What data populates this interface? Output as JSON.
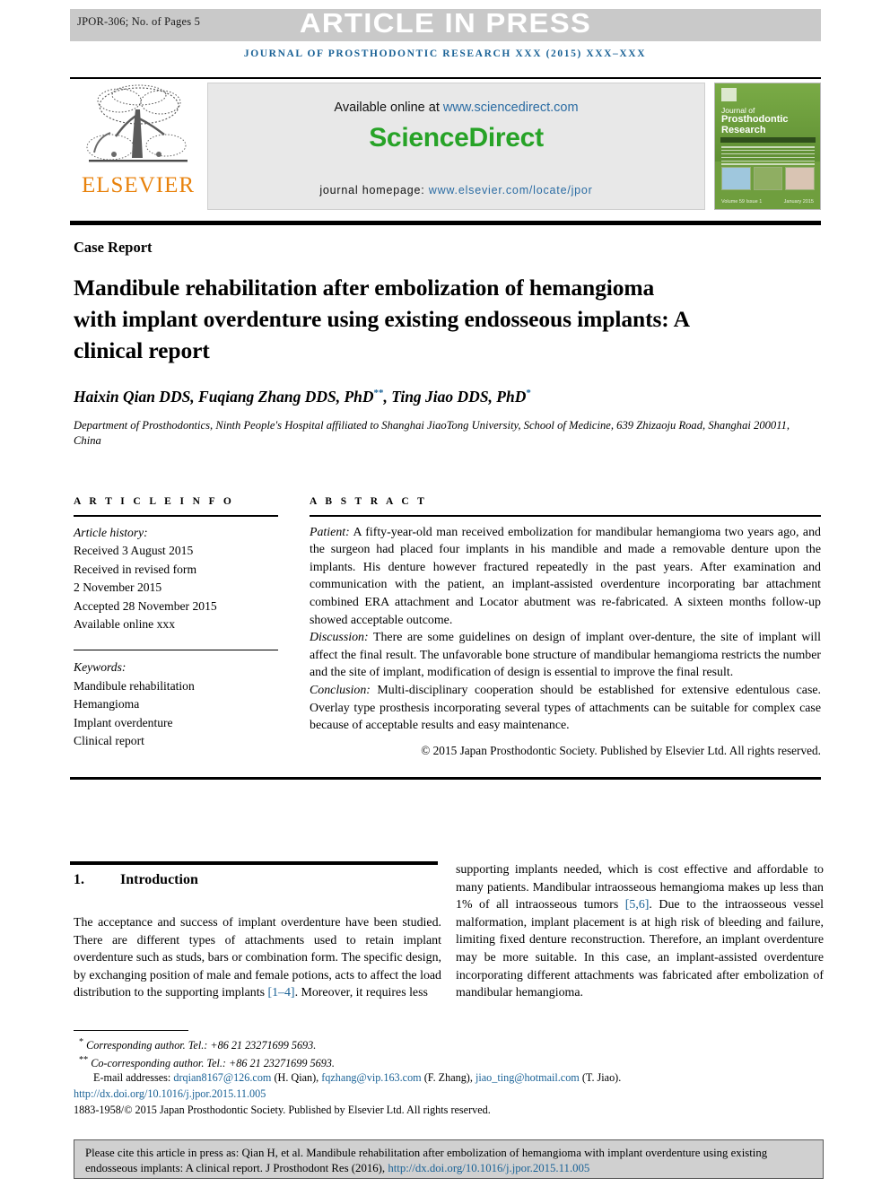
{
  "header": {
    "jpor_code": "JPOR-306; No. of Pages 5",
    "press_banner": "ARTICLE IN PRESS",
    "journal_line": "JOURNAL OF PROSTHODONTIC RESEARCH XXX (2015) XXX–XXX",
    "band_color": "#c9c9c9",
    "journal_line_color": "#1a6296"
  },
  "masthead": {
    "elsevier_wordmark": "ELSEVIER",
    "elsevier_color": "#e8820c",
    "available_prefix": "Available online at ",
    "available_link": "www.sciencedirect.com",
    "sciencedirect_logo": "ScienceDirect",
    "sciencedirect_color": "#27a327",
    "homepage_prefix": "journal homepage: ",
    "homepage_link": "www.elsevier.com/locate/jpor",
    "cover": {
      "line1": "Journal of",
      "line2": "Prosthodontic Research",
      "society": "Official Journal of Japan Prosthodontic Society",
      "bullets": [
        "Effect of implant-supported removable partial dentures on oral health related quality of life",
        "Clinical outcomes of implant placement in the posterior mandible"
      ],
      "volume": "Volume 59 Issue 1",
      "date": "January 2015",
      "cover_color": "#6f9e3e"
    }
  },
  "article": {
    "type": "Case Report",
    "title": "Mandibule rehabilitation after embolization of hemangioma with implant overdenture using existing endosseous implants: A clinical report",
    "authors": "Haixin Qian DDS, Fuqiang Zhang DDS, PhD",
    "author_mark_1": "**",
    "authors_cont": ", Ting Jiao DDS, PhD",
    "author_mark_2": "*",
    "affiliation": "Department of Prosthodontics, Ninth People's Hospital affiliated to Shanghai JiaoTong University, School of Medicine, 639 Zhizaoju Road, Shanghai 200011, China"
  },
  "article_info": {
    "heading": "A R T I C L E   I N F O",
    "history_label": "Article history:",
    "history": [
      "Received 3 August 2015",
      "Received in revised form",
      "2 November 2015",
      "Accepted 28 November 2015",
      "Available online xxx"
    ],
    "keywords_label": "Keywords:",
    "keywords": [
      "Mandibule rehabilitation",
      "Hemangioma",
      "Implant overdenture",
      "Clinical report"
    ]
  },
  "abstract": {
    "heading": "A B S T R A C T",
    "patient_label": "Patient:",
    "patient_text": " A fifty-year-old man received embolization for mandibular hemangioma two years ago, and the surgeon had placed four implants in his mandible and made a removable denture upon the implants. His denture however fractured repeatedly in the past years. After examination and communication with the patient, an implant-assisted overdenture incorporating bar attachment combined ERA attachment and Locator abutment was re-fabricated. A sixteen months follow-up showed acceptable outcome.",
    "discussion_label": "Discussion:",
    "discussion_text": " There are some guidelines on design of implant over-denture, the site of implant will affect the final result. The unfavorable bone structure of mandibular hemangioma restricts the number and the site of implant, modification of design is essential to improve the final result.",
    "conclusion_label": "Conclusion:",
    "conclusion_text": " Multi-disciplinary cooperation should be established for extensive edentulous case. Overlay type prosthesis incorporating several types of attachments can be suitable for complex case because of acceptable results and easy maintenance.",
    "copyright": "© 2015 Japan Prosthodontic Society. Published by Elsevier Ltd. All rights reserved."
  },
  "body": {
    "section_number": "1.",
    "section_title": "Introduction",
    "left_p1_a": "The acceptance and success of implant overdenture have been studied. There are different types of attachments used to retain implant overdenture such as studs, bars or combination form. The specific design, by exchanging position of male and female potions, acts to affect the load distribution to the supporting implants ",
    "left_ref1": "[1–4]",
    "left_p1_b": ". Moreover, it requires less",
    "right_p1_a": "supporting implants needed, which is cost effective and affordable to many patients. Mandibular intraosseous hemangioma makes up less than 1% of all intraosseous tumors ",
    "right_ref1": "[5,6]",
    "right_p1_b": ". Due to the intraosseous vessel malformation, implant placement is at high risk of bleeding and failure, limiting fixed denture reconstruction. Therefore, an implant overdenture may be more suitable. In this case, an implant-assisted overdenture incorporating different attachments was fabricated after embolization of mandibular hemangioma."
  },
  "footnotes": {
    "corresponding_mark": "*",
    "corresponding": " Corresponding author. Tel.: +86 21 23271699 5693.",
    "co_corresponding_mark": "**",
    "co_corresponding": " Co-corresponding author. Tel.: +86 21 23271699 5693.",
    "email_label": "E-mail addresses: ",
    "email1": "drqian8167@126.com",
    "email1_who": " (H. Qian), ",
    "email2": "fqzhang@vip.163.com",
    "email2_who": " (F. Zhang), ",
    "email3": "jiao_ting@hotmail.com",
    "email3_who": " (T. Jiao).",
    "doi": "http://dx.doi.org/10.1016/j.jpor.2015.11.005",
    "issn": "1883-1958/© 2015 Japan Prosthodontic Society. Published by Elsevier Ltd. All rights reserved."
  },
  "cite_box": {
    "text": "Please cite this article in press as: Qian H, et al. Mandibule rehabilitation after embolization of hemangioma with implant overdenture using existing endosseous implants: A clinical report. J Prosthodont Res (2016), ",
    "link": "http://dx.doi.org/10.1016/j.jpor.2015.11.005"
  }
}
